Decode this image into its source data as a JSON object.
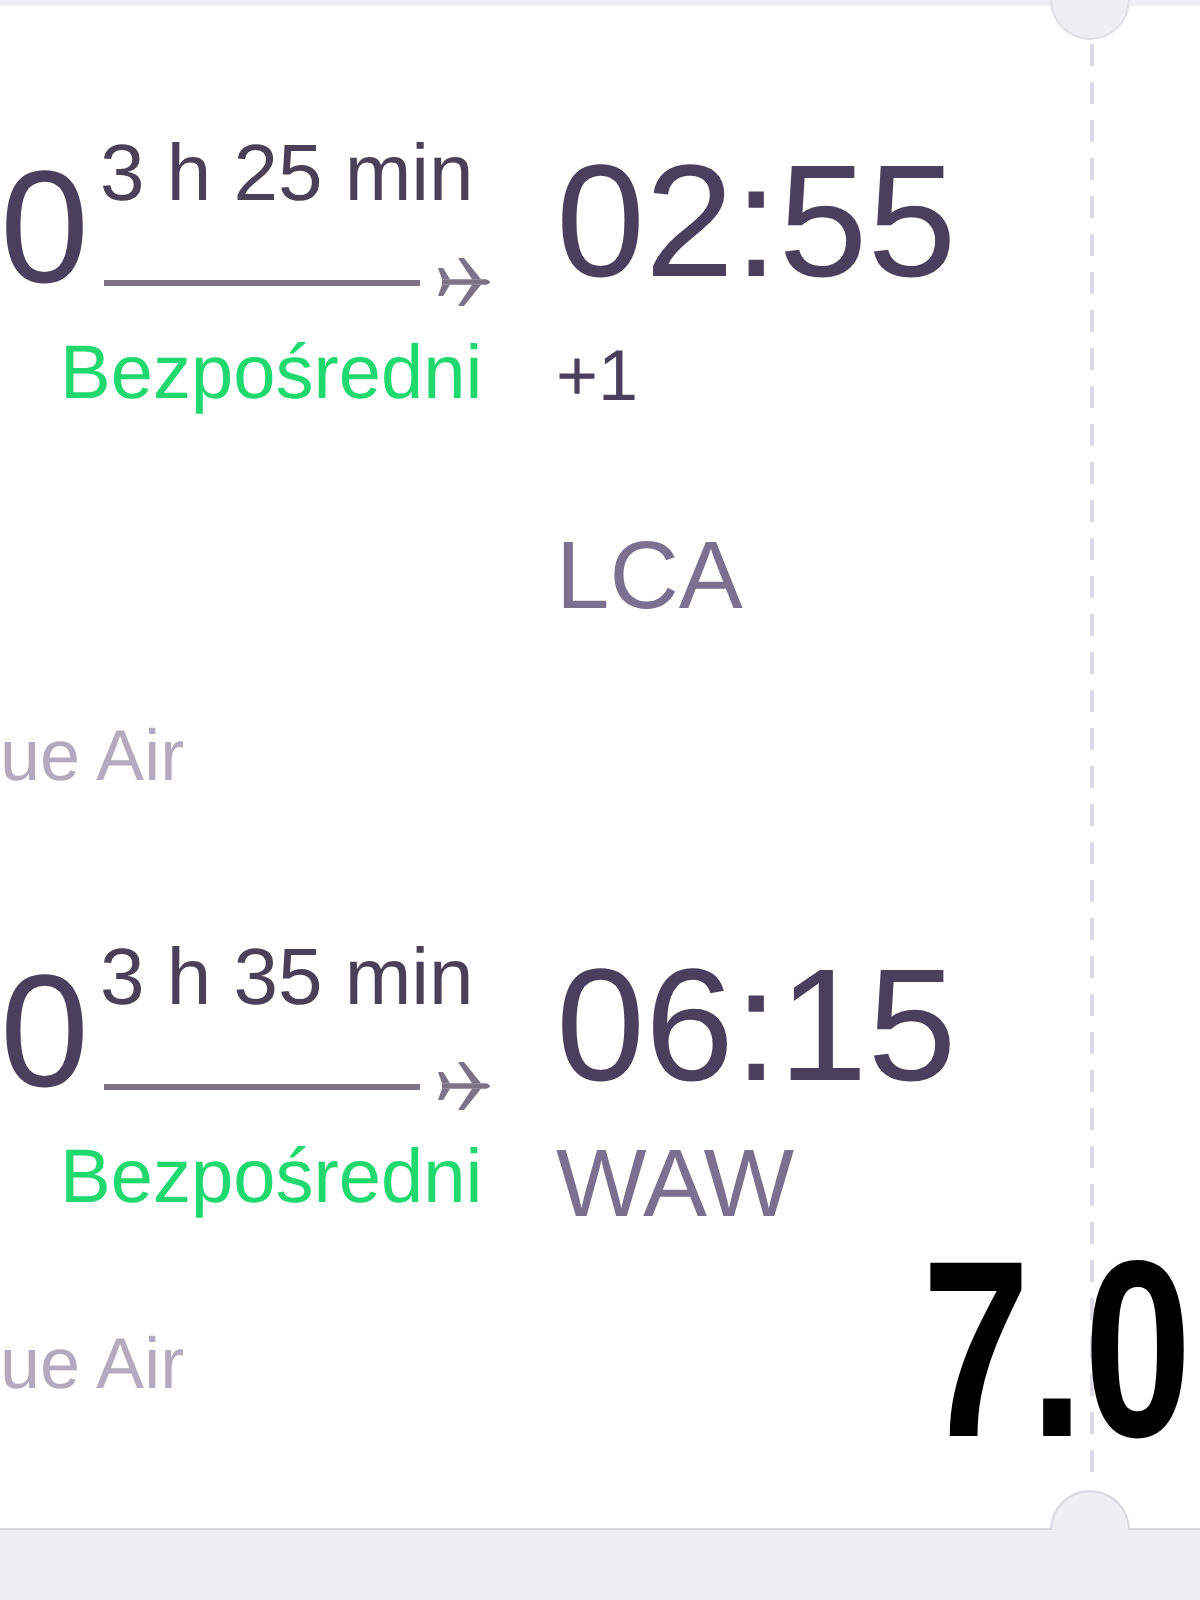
{
  "segments": [
    {
      "departure_time": "0",
      "duration": "3 h 25 min",
      "stops": "Bezpośredni",
      "arrival_time": "02:55",
      "day_offset": "+1",
      "arrival_airport": "LCA",
      "carrier": "ue Air"
    },
    {
      "departure_time": "0",
      "duration": "3 h 35 min",
      "stops": "Bezpośredni",
      "arrival_time": "06:15",
      "arrival_airport": "WAW",
      "carrier": "ue Air"
    }
  ],
  "overlay_text": "7.0"
}
